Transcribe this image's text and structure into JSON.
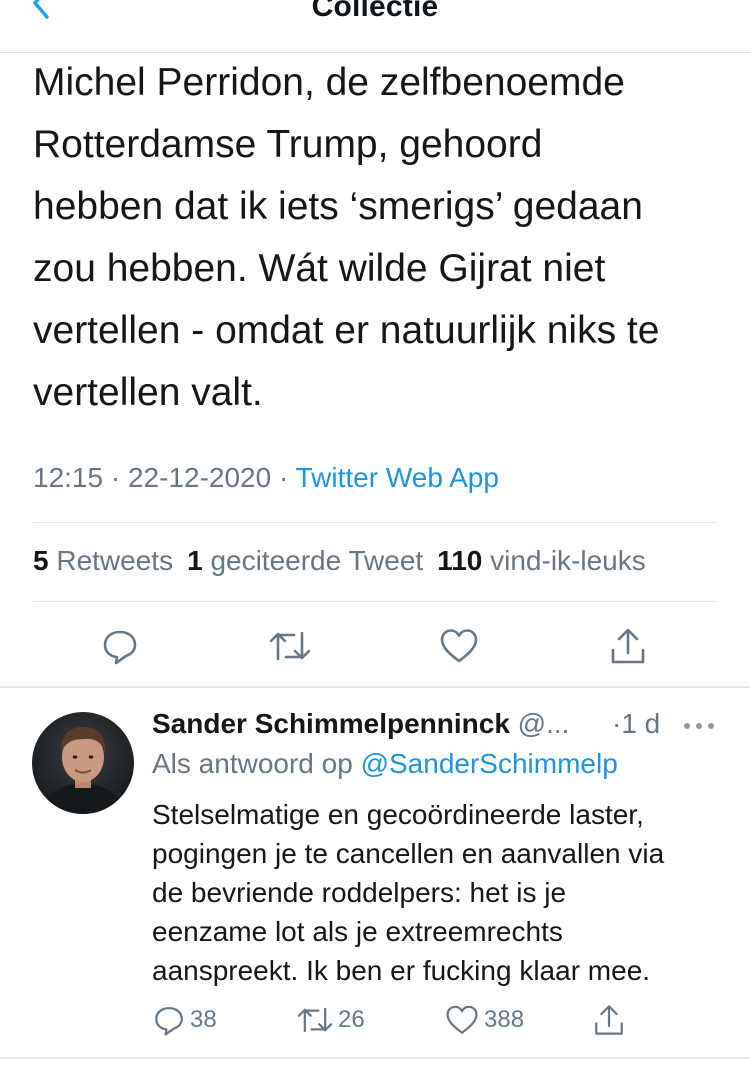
{
  "nav": {
    "title": "Collectie",
    "back_icon": "chevron-left-icon"
  },
  "tweet": {
    "text": "Michel Perridon, de zelfbenoemde\nRotterdamse Trump, gehoord\nhebben dat ik iets ‘smerigs’ gedaan\nzou hebben. Wát wilde Gijrat niet\nvertellen - omdat er natuurlijk niks te\nvertellen valt.",
    "time": "12:15",
    "date": "22-12-2020",
    "dot": "·",
    "source": "Twitter Web App"
  },
  "stats": {
    "retweets_count": "5",
    "retweets_label": "Retweets",
    "quotes_count": "1",
    "quotes_label": "geciteerde Tweet",
    "likes_count": "110",
    "likes_label": "vind-ik-leuks"
  },
  "actions": [
    "reply-icon",
    "retweet-icon",
    "like-icon",
    "share-icon"
  ],
  "reply": {
    "name": "Sander Schimmelpenninck",
    "handle": "@...",
    "time": "·1 d",
    "reply_prefix": "Als antwoord op",
    "reply_mention": "@SanderSchimmelp",
    "text": "Stelselmatige en gecoördineerde laster,\npogingen je te cancellen en aanvallen via\nde bevriende roddelpers: het is je\neenzame lot als je extreemrechts\naanspreekt. Ik ben er fucking klaar mee.",
    "reply_count": "38",
    "retweet_count": "26",
    "like_count": "388"
  },
  "colors": {
    "accent": "#1b95e0",
    "muted": "#657786",
    "text": "#14171a",
    "divider": "#e1e6ea"
  }
}
